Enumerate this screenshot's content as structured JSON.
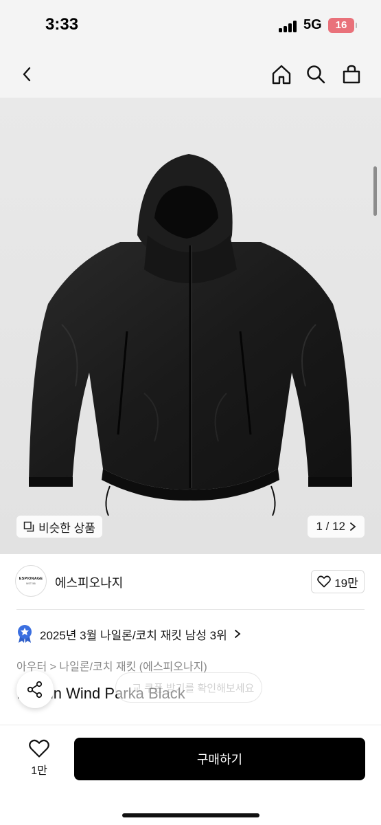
{
  "status_bar": {
    "time": "3:33",
    "network": "5G",
    "battery": "16"
  },
  "nav": {
    "back_icon": "chevron-left-icon",
    "home_icon": "home-icon",
    "search_icon": "search-icon",
    "cart_icon": "shopping-bag-icon"
  },
  "gallery": {
    "similar_label": "비슷한 상품",
    "page_indicator": "1 / 12"
  },
  "brand": {
    "logo_text": "ESPIONAGE",
    "logo_subtext": "NST 56",
    "name": "에스피오나지",
    "like_count": "19만"
  },
  "ranking": {
    "text": "2025년 3월 나일론/코치 재킷 남성 3위"
  },
  "product": {
    "category": "아우터 > 나일론/코치 재킷 (에스피오나지)",
    "title": "...ntain Wind Parka Black",
    "tooltip_ghost": "...교 쿠폰 받기를 확인해보세요"
  },
  "bottom_bar": {
    "wish_count": "1만",
    "buy_label": "구매하기"
  },
  "colors": {
    "accent": "#000000",
    "badge": "#3b6fe0",
    "battery": "#e9717a"
  }
}
